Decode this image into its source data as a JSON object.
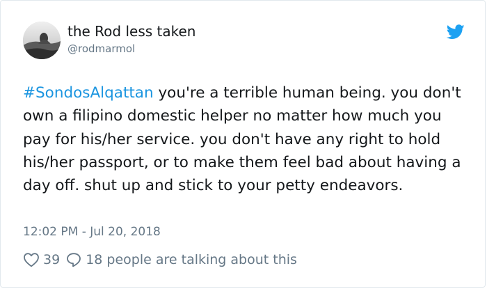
{
  "author": {
    "name": "the Rod less taken",
    "handle": "@rodmarmol"
  },
  "tweet": {
    "hashtag": "#SondosAlqattan",
    "text": " you're a terrible human being. you don't own a filipino domestic helper no matter how much you pay for his/her service. you don't have any right to hold his/her passport, or to make them feel bad about having a day off. shut up and stick to your petty endeavors."
  },
  "timestamp": "12:02 PM - Jul 20, 2018",
  "engagement": {
    "likes": "39",
    "talking": "18 people are talking about this"
  },
  "icons": {
    "brand": "twitter-bird-icon",
    "like": "heart-outline-icon",
    "reply": "speech-bubble-icon"
  },
  "colors": {
    "hashtag": "#1b95e0",
    "twitter_blue": "#1da1f2",
    "muted": "#657786",
    "text": "#14171a"
  }
}
